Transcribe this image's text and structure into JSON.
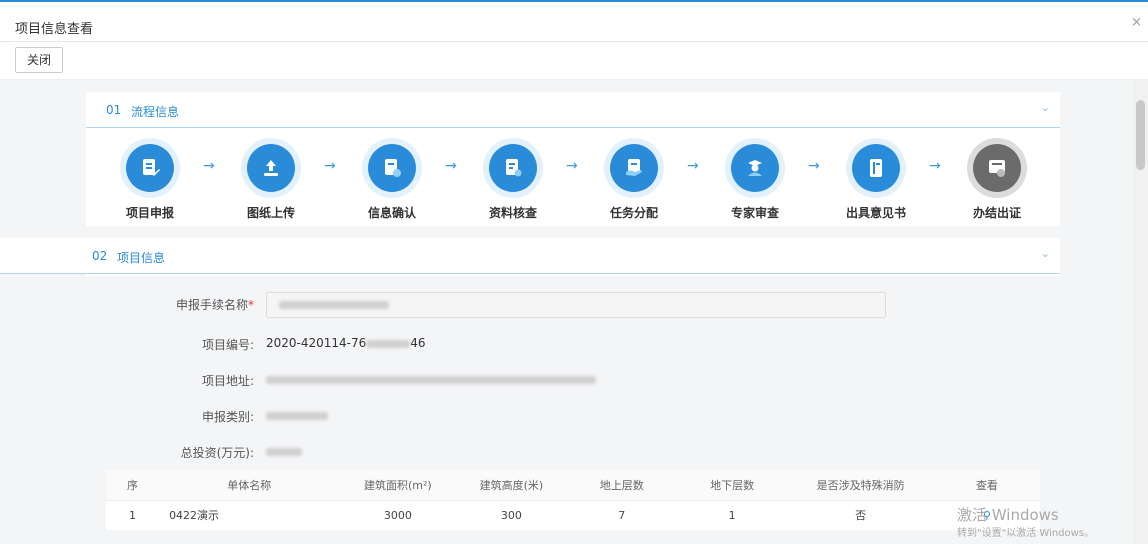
{
  "window": {
    "title": "项目信息查看",
    "close_glyph": "×"
  },
  "toolbar": {
    "close_label": "关闭"
  },
  "flow": {
    "num": "01",
    "title": "流程信息",
    "steps": [
      {
        "label": "项目申报",
        "icon": "edit-document-icon"
      },
      {
        "label": "图纸上传",
        "icon": "upload-icon"
      },
      {
        "label": "信息确认",
        "icon": "confirm-document-icon"
      },
      {
        "label": "资料核查",
        "icon": "review-document-icon"
      },
      {
        "label": "任务分配",
        "icon": "assign-task-icon"
      },
      {
        "label": "专家审查",
        "icon": "expert-icon"
      },
      {
        "label": "出具意见书",
        "icon": "book-icon"
      },
      {
        "label": "办结出证",
        "icon": "certificate-icon"
      }
    ],
    "arrow_glyph": "→",
    "active_color": "#2a8bd8",
    "inactive_color": "#6b6b6b"
  },
  "project": {
    "num": "02",
    "title": "项目信息",
    "fields": {
      "name_label": "申报手续名称",
      "required_mark": "*",
      "code_label": "项目编号:",
      "code_prefix": "2020-420114-76",
      "code_suffix": "46",
      "address_label": "项目地址:",
      "category_label": "申报类别:",
      "investment_label": "总投资(万元):"
    },
    "table": {
      "headers": [
        "序",
        "单体名称",
        "建筑面积(m²)",
        "建筑高度(米)",
        "地上层数",
        "地下层数",
        "是否涉及特殊消防",
        "查看"
      ],
      "rows": [
        [
          "1",
          "0422演示",
          "3000",
          "300",
          "7",
          "1",
          "否",
          ""
        ]
      ]
    }
  },
  "watermark": {
    "line1": "激活 Windows",
    "line2": "转到\"设置\"以激活 Windows。"
  }
}
